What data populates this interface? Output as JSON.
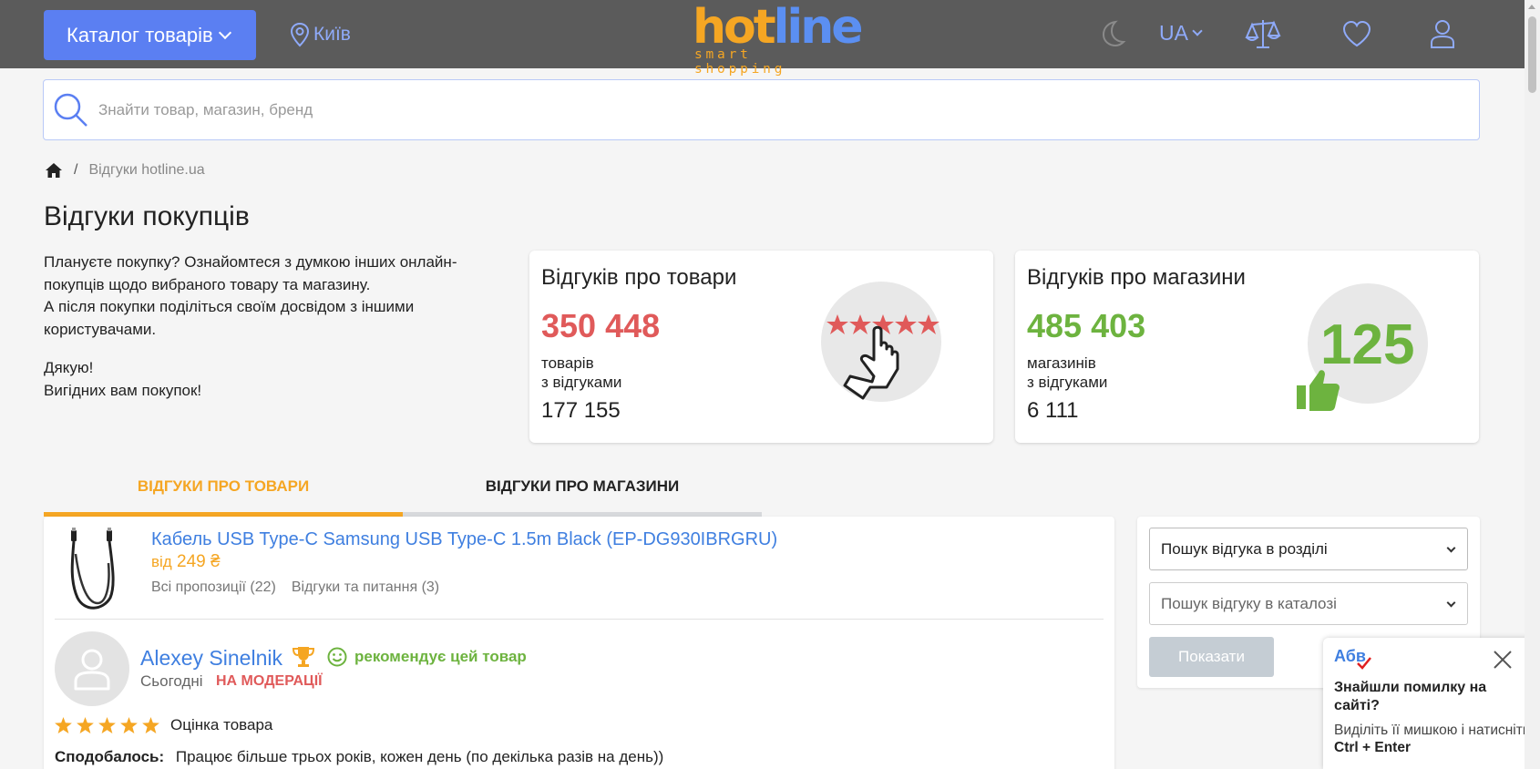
{
  "header": {
    "catalog_label": "Каталог товарів",
    "city": "Київ",
    "logo_hot": "hot",
    "logo_line": "line",
    "logo_tagline": "smart shopping",
    "language": "UA"
  },
  "search": {
    "placeholder": "Знайти товар, магазин, бренд"
  },
  "breadcrumb": {
    "separator": "/",
    "current": "Відгуки hotline.ua"
  },
  "page": {
    "title": "Відгуки покупців",
    "intro_1": "Плануєте покупку? Ознайомтеся з думкою інших онлайн-покупців щодо вибраного товару та магазину.",
    "intro_2": "А після покупки поділіться своїм досвідом з іншими користувачами.",
    "thanks_1": "Дякую!",
    "thanks_2": "Вигідних вам покупок!"
  },
  "stats": {
    "products": {
      "title": "Відгуків про товари",
      "count": "350 448",
      "count_color": "#e05a5a",
      "sub_1": "товарів",
      "sub_2": "з відгуками",
      "total": "177 155"
    },
    "shops": {
      "title": "Відгуків про магазини",
      "count": "485 403",
      "count_color": "#6db33f",
      "sub_1": "магазинів",
      "sub_2": "з відгуками",
      "total": "6 111",
      "badge": "125"
    }
  },
  "tabs": {
    "products": "Відгуки про товари",
    "shops": "Відгуки про магазини"
  },
  "review": {
    "product_name": "Кабель USB Type-C Samsung USB Type-C 1.5m Black (EP-DG930IBRGRU)",
    "price_from": "від",
    "price": "249 ₴",
    "all_offers": "Всі пропозиції (22)",
    "questions": "Відгуки та питання (3)",
    "author": "Alexey Sinelnik",
    "recommends": "рекомендує цей товар",
    "date": "Сьогодні",
    "status": "НА МОДЕРАЦІЇ",
    "rating_stars": 5,
    "rating_label": "Оцінка товара",
    "liked_label": "Сподобалось:",
    "liked_text": "Працює більше трьох років, кожен день (по декілька разів на день))"
  },
  "filters": {
    "section_select": "Пошук відгука в розділі",
    "catalog_select": "Пошук відгуку в каталозі",
    "show_button": "Показати"
  },
  "error_popup": {
    "logo": "Абв",
    "title": "Знайшли помилку на сайті?",
    "desc_1": "Виділіть її мишкою і натисніть",
    "desc_keys": "Ctrl + Enter"
  },
  "colors": {
    "header_bg": "#5b5b5b",
    "accent_blue": "#5b7ff2",
    "accent_orange": "#f5a623",
    "link_blue": "#3f7fe0",
    "green": "#6db33f",
    "red": "#e05a5a"
  }
}
